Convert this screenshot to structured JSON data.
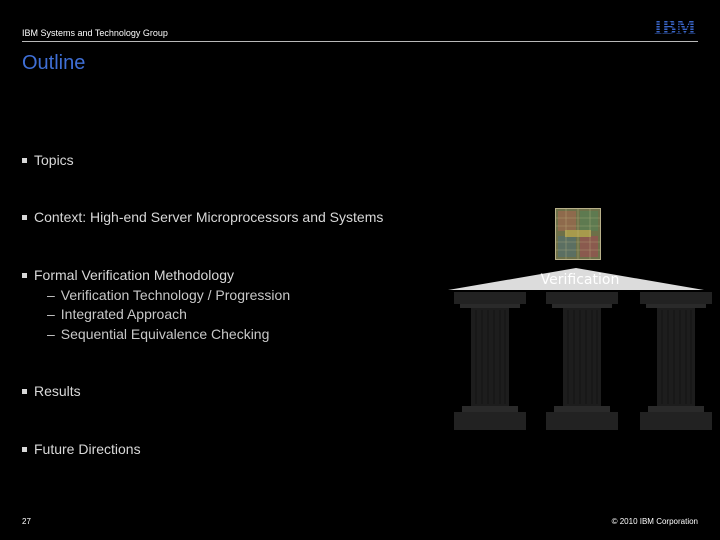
{
  "header": {
    "group": "IBM Systems and Technology Group",
    "logo_text": "IBM"
  },
  "slide": {
    "title": "Outline",
    "bullets": [
      "Topics",
      "Context: High-end Server Microprocessors and Systems",
      "Formal Verification Methodology",
      "Results",
      "Future Directions"
    ],
    "sub_bullets": [
      "Verification Technology / Progression",
      "Integrated Approach",
      "Sequential Equivalence Checking"
    ],
    "sub_bullet_dash": "–"
  },
  "diagram": {
    "label": "Verification"
  },
  "footer": {
    "page_number": "27",
    "copyright": "© 2010 IBM Corporation"
  },
  "colors": {
    "background": "#000000",
    "title": "#3f6fd6",
    "text": "#d8d8d8"
  }
}
